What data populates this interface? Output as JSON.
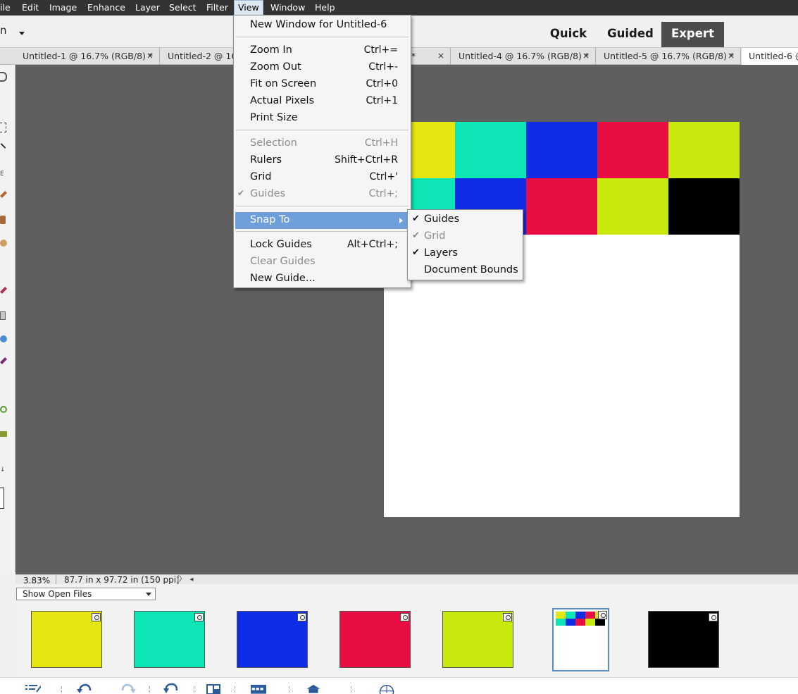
{
  "menubar": {
    "items": [
      "ile",
      "Edit",
      "Image",
      "Enhance",
      "Layer",
      "Select",
      "Filter",
      "View",
      "Window",
      "Help"
    ],
    "active": "View"
  },
  "modebar": {
    "app_mode_partial": "n",
    "modes": [
      "Quick",
      "Guided",
      "Expert"
    ],
    "active_mode": "Expert"
  },
  "tabs": [
    "Untitled-1 @ 16.7% (RGB/8) *",
    "Untitled-2 @ 16.",
    "* ",
    "Untitled-4 @ 16.7% (RGB/8) *",
    "Untitled-5 @ 16.7% (RGB/8) *",
    "Untitled-6 @"
  ],
  "tab_close_glyph": "×",
  "view_menu": {
    "items": [
      {
        "label": "New Window for Untitled-6",
        "shortcut": "",
        "disabled": false
      },
      {
        "label": "Zoom In",
        "shortcut": "Ctrl+=",
        "disabled": false
      },
      {
        "label": "Zoom Out",
        "shortcut": "Ctrl+-",
        "disabled": false
      },
      {
        "label": "Fit on Screen",
        "shortcut": "Ctrl+0",
        "disabled": false
      },
      {
        "label": "Actual Pixels",
        "shortcut": "Ctrl+1",
        "disabled": false
      },
      {
        "label": "Print Size",
        "shortcut": "",
        "disabled": false
      },
      {
        "label": "Selection",
        "shortcut": "Ctrl+H",
        "disabled": true
      },
      {
        "label": "Rulers",
        "shortcut": "Shift+Ctrl+R",
        "disabled": false
      },
      {
        "label": "Grid",
        "shortcut": "Ctrl+'",
        "disabled": false
      },
      {
        "label": "Guides",
        "shortcut": "Ctrl+;",
        "disabled": true,
        "checked": true
      },
      {
        "label": "Snap To",
        "shortcut": "",
        "disabled": false,
        "highlighted": true,
        "submenu": true
      },
      {
        "label": "Lock Guides",
        "shortcut": "Alt+Ctrl+;",
        "disabled": false
      },
      {
        "label": "Clear Guides",
        "shortcut": "",
        "disabled": true
      },
      {
        "label": "New Guide...",
        "shortcut": "",
        "disabled": false
      }
    ],
    "check_glyph": "✔"
  },
  "snap_submenu": {
    "items": [
      {
        "label": "Guides",
        "checked": true,
        "disabled": false
      },
      {
        "label": "Grid",
        "checked": true,
        "disabled": true
      },
      {
        "label": "Layers",
        "checked": true,
        "disabled": false
      },
      {
        "label": "Document Bounds",
        "checked": false,
        "disabled": false
      }
    ]
  },
  "document": {
    "grid_colors": [
      [
        "#e6e610",
        "#0ce6b4",
        "#0e2ce6",
        "#e80e44",
        "#c8e80e"
      ],
      [
        "#0ce6b4",
        "#0e2ce6",
        "#e80e44",
        "#c8e80e",
        "#000000"
      ]
    ]
  },
  "status": {
    "zoom": "3.83%",
    "doc_size": "87.7 in x 97.72 in (150 ppi)",
    "next_glyph": "〉",
    "scroll_glyph": "◂"
  },
  "photobin": {
    "select_label": "Show Open Files",
    "thumbnails": [
      {
        "color": "#e6e610"
      },
      {
        "color": "#0ce6b4"
      },
      {
        "color": "#0e2ce6"
      },
      {
        "color": "#e80e44"
      },
      {
        "color": "#c8e80e"
      },
      {
        "color": "mosaic",
        "active": true
      },
      {
        "color": "#000000"
      }
    ]
  },
  "taskbar_icons": [
    "task-list-icon",
    "undo-icon",
    "redo-icon",
    "rotate-icon",
    "layout-icon",
    "organizer-icon",
    "home-screen-icon",
    "web-icon"
  ]
}
